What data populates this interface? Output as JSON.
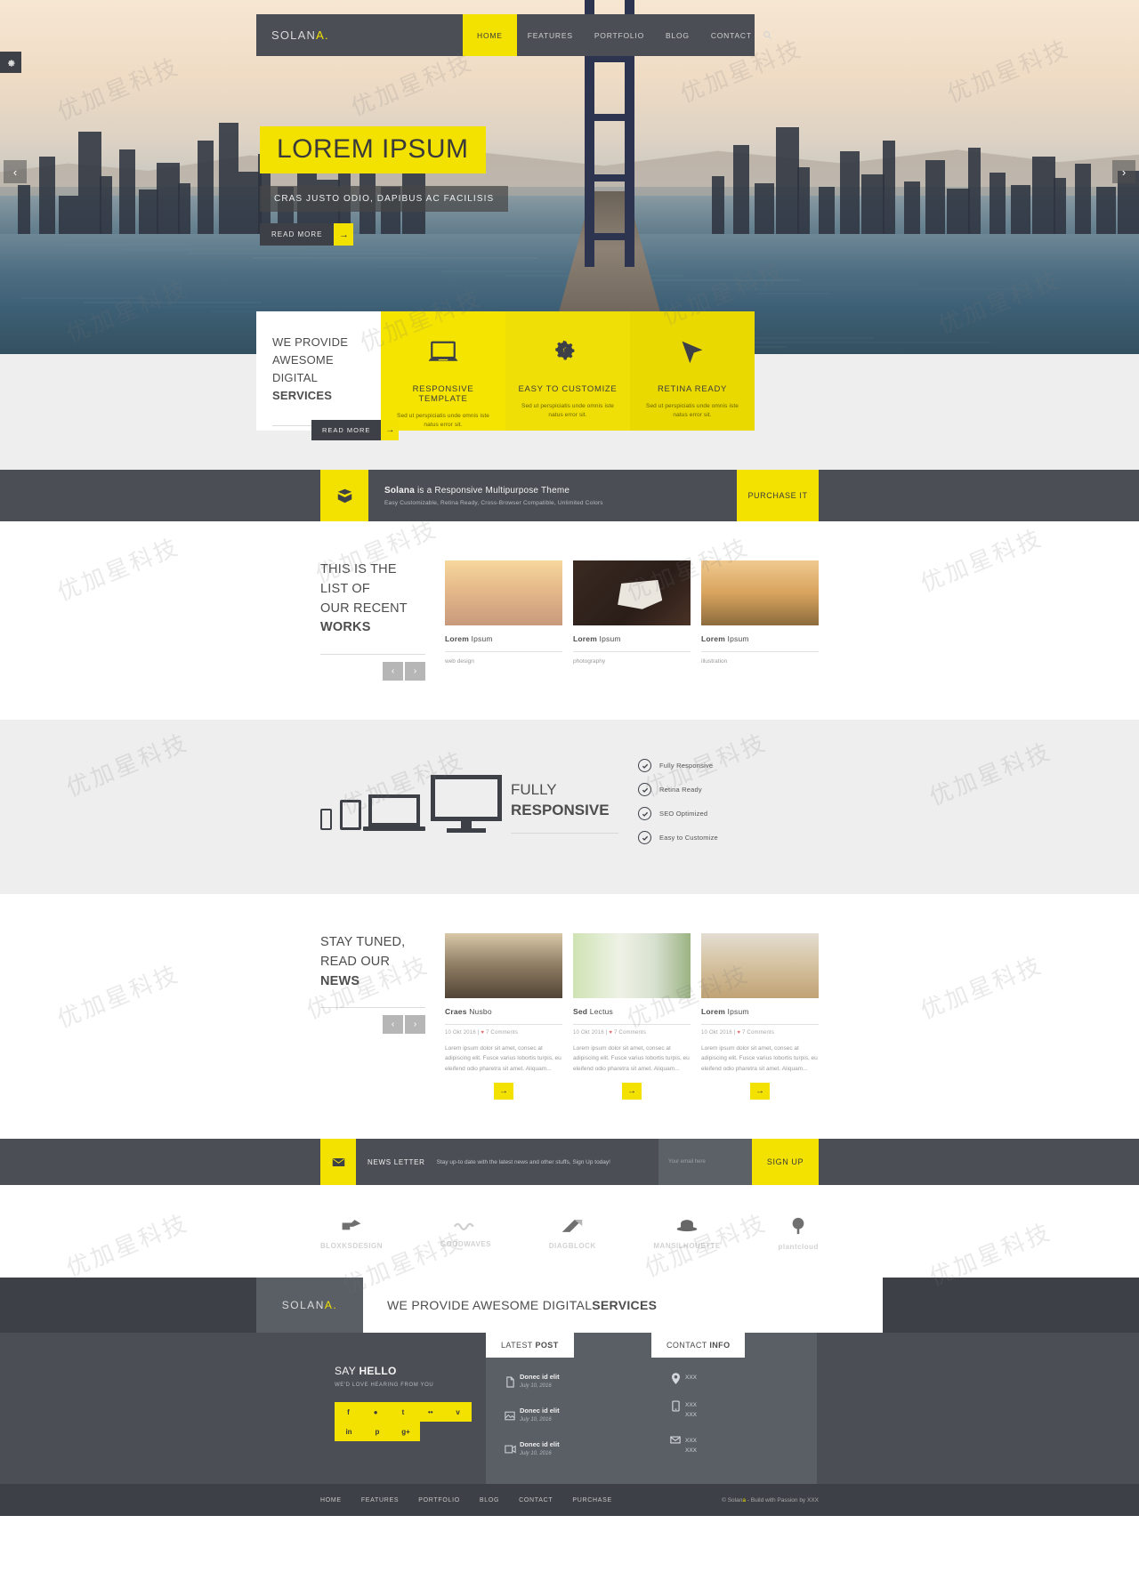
{
  "nav": {
    "logo_main": "SOLAN",
    "logo_accent": "A.",
    "items": [
      {
        "label": "HOME",
        "active": true
      },
      {
        "label": "FEATURES",
        "active": false
      },
      {
        "label": "PORTFOLIO",
        "active": false
      },
      {
        "label": "BLOG",
        "active": false
      },
      {
        "label": "CONTACT",
        "active": false
      }
    ],
    "search_icon": "search-icon"
  },
  "hero": {
    "title": "LOREM IPSUM",
    "subtitle": "CRAS JUSTO ODIO, DAPIBUS AC FACILISIS",
    "button": "READ MORE",
    "button_arrow": "→",
    "prev": "‹",
    "next": "›",
    "gear_icon": "gear-icon"
  },
  "services": {
    "intro_line1": "WE PROVIDE",
    "intro_line2": "AWESOME DIGITAL",
    "intro_line3": "SERVICES",
    "read_more": "READ MORE",
    "read_more_arrow": "→",
    "cards": [
      {
        "icon": "laptop-icon",
        "name": "RESPONSIVE TEMPLATE",
        "desc": "Sed ut perspiciatis unde omnis iste natus error sit."
      },
      {
        "icon": "gears-icon",
        "name": "EASY TO CUSTOMIZE",
        "desc": "Sed ut perspiciatis unde omnis iste natus error sit."
      },
      {
        "icon": "cursor-icon",
        "name": "RETINA READY",
        "desc": "Sed ut perspiciatis unde omnis iste natus error sit."
      }
    ]
  },
  "purchase": {
    "icon": "box-icon",
    "title_bold": "Solana",
    "title_rest": " is a Responsive Multipurpose Theme",
    "subtitle": "Easy Customizable, Retina Ready, Cross-Browser Compatible, Unlimited Colors",
    "button": "PURCHASE IT"
  },
  "works": {
    "heading_line1": "THIS IS THE LIST OF",
    "heading_line2": "OUR RECENT",
    "heading_line3": "WORKS",
    "prev": "‹",
    "next": "›",
    "items": [
      {
        "title_bold": "Lorem",
        "title_rest": " Ipsum",
        "category": "web design",
        "thumb": "t-field"
      },
      {
        "title_bold": "Lorem",
        "title_rest": " Ipsum",
        "category": "photography",
        "thumb": "t-love"
      },
      {
        "title_bold": "Lorem",
        "title_rest": " Ipsum",
        "category": "illustration",
        "thumb": "t-road"
      }
    ]
  },
  "responsive": {
    "title_line1": "FULLY",
    "title_line2": "RESPONSIVE",
    "checks": [
      {
        "label": "Fully Responsive"
      },
      {
        "label": "Retina Ready"
      },
      {
        "label": "SEO Optimized"
      },
      {
        "label": "Easy to Customize"
      }
    ],
    "check_icon": "check-circle-icon"
  },
  "news": {
    "heading_line1": "STAY TUNED,",
    "heading_line2": "READ OUR",
    "heading_line3": "NEWS",
    "prev": "‹",
    "next": "›",
    "posts": [
      {
        "title_bold": "Craes",
        "title_rest": " Nusbo",
        "date": "10 Okt 2016",
        "comments": "7 Comments",
        "excerpt": "Lorem ipsum dolor sit amet, consec at adipiscing elit. Fusce varius lobortis turpis, eu eleifend odio pharetra sit amet. Aliquam...",
        "thumb": "t-brush",
        "more": "→"
      },
      {
        "title_bold": "Sed",
        "title_rest": " Lectus",
        "date": "10 Okt 2016",
        "comments": "7 Comments",
        "excerpt": "Lorem ipsum dolor sit amet, consec at adipiscing elit. Fusce varius lobortis turpis, eu eleifend odio pharetra sit amet. Aliquam...",
        "thumb": "t-girl",
        "more": "→"
      },
      {
        "title_bold": "Lorem",
        "title_rest": " Ipsum",
        "date": "10 Okt 2016",
        "comments": "7 Comments",
        "excerpt": "Lorem ipsum dolor sit amet, consec at adipiscing elit. Fusce varius lobortis turpis, eu eleifend odio pharetra sit amet. Aliquam...",
        "thumb": "t-beach",
        "more": "→"
      }
    ]
  },
  "newsletter": {
    "icon": "envelope-icon",
    "label": "NEWS LETTER",
    "desc": "Stay up-to date with the latest news and other stuffs, Sign Up today!",
    "input_placeholder": "Your email here",
    "button": "SIGN UP"
  },
  "clients": [
    {
      "name": "BLOXKS",
      "suffix": "DESIGN",
      "icon": "camera-icon"
    },
    {
      "name": "GOOD",
      "suffix": "WAVES",
      "icon": "wave-icon"
    },
    {
      "name": "DIAG",
      "suffix": "BLOCK",
      "icon": "diagonal-icon"
    },
    {
      "name": "MAN",
      "suffix": "SILHOUETTE",
      "icon": "hat-icon"
    },
    {
      "name": "plant",
      "suffix": "cloud",
      "icon": "tree-icon"
    }
  ],
  "footer": {
    "logo_main": "SOLAN",
    "logo_accent": "A.",
    "tagline_normal": "WE PROVIDE AWESOME DIGITAL ",
    "tagline_bold": "SERVICES",
    "hello_normal": "SAY ",
    "hello_bold": "HELLO",
    "hello_sub": "WE'D LOVE HEARING FROM YOU",
    "social": [
      {
        "icon": "facebook-icon",
        "glyph": "f"
      },
      {
        "icon": "dribbble-icon",
        "glyph": "●"
      },
      {
        "icon": "twitter-icon",
        "glyph": "t"
      },
      {
        "icon": "flickr-icon",
        "glyph": "••"
      },
      {
        "icon": "vimeo-icon",
        "glyph": "v"
      },
      {
        "icon": "linkedin-icon",
        "glyph": "in"
      },
      {
        "icon": "pinterest-icon",
        "glyph": "p"
      },
      {
        "icon": "googleplus-icon",
        "glyph": "g+"
      }
    ],
    "latest_post_tab_normal": "LATEST ",
    "latest_post_tab_bold": "POST",
    "posts": [
      {
        "title": "Donec id elit",
        "date": "July 10, 2016",
        "icon": "document-icon"
      },
      {
        "title": "Donec id elit",
        "date": "July 10, 2016",
        "icon": "image-icon"
      },
      {
        "title": "Donec id elit",
        "date": "July 10, 2016",
        "icon": "video-icon"
      }
    ],
    "contact_tab_normal": "CONTACT ",
    "contact_tab_bold": "INFO",
    "contacts": [
      {
        "icon": "location-icon",
        "lines": [
          "XXX"
        ]
      },
      {
        "icon": "phone-icon",
        "lines": [
          "XXX",
          "XXX"
        ]
      },
      {
        "icon": "mail-icon",
        "lines": [
          "XXX",
          "XXX"
        ]
      }
    ],
    "bottom_nav": [
      "HOME",
      "FEATURES",
      "PORTFOLIO",
      "BLOG",
      "CONTACT",
      "PURCHASE"
    ],
    "copy_pre": "© Solan",
    "copy_accent": "a",
    "copy_post": " - Build with Passion by XXX"
  },
  "watermarks": [
    "优加星科技",
    "优加星科技",
    "优加星科技",
    "优加星科技",
    "优加星科技",
    "优加星科技",
    "优加星科技",
    "优加星科技",
    "优加星科技",
    "优加星科技",
    "优加星科技",
    "优加星科技",
    "优加星科技",
    "优加星科技",
    "优加星科技",
    "优加星科技",
    "优加星科技",
    "优加星科技",
    "优加星科技",
    "优加星科技",
    "优加星科技",
    "优加星科技",
    "优加星科技",
    "优加星科技"
  ],
  "colors": {
    "accent": "#f3e200",
    "dark": "#4b4f55",
    "darker": "#3d4147",
    "grey_bg": "#eeeeee"
  }
}
